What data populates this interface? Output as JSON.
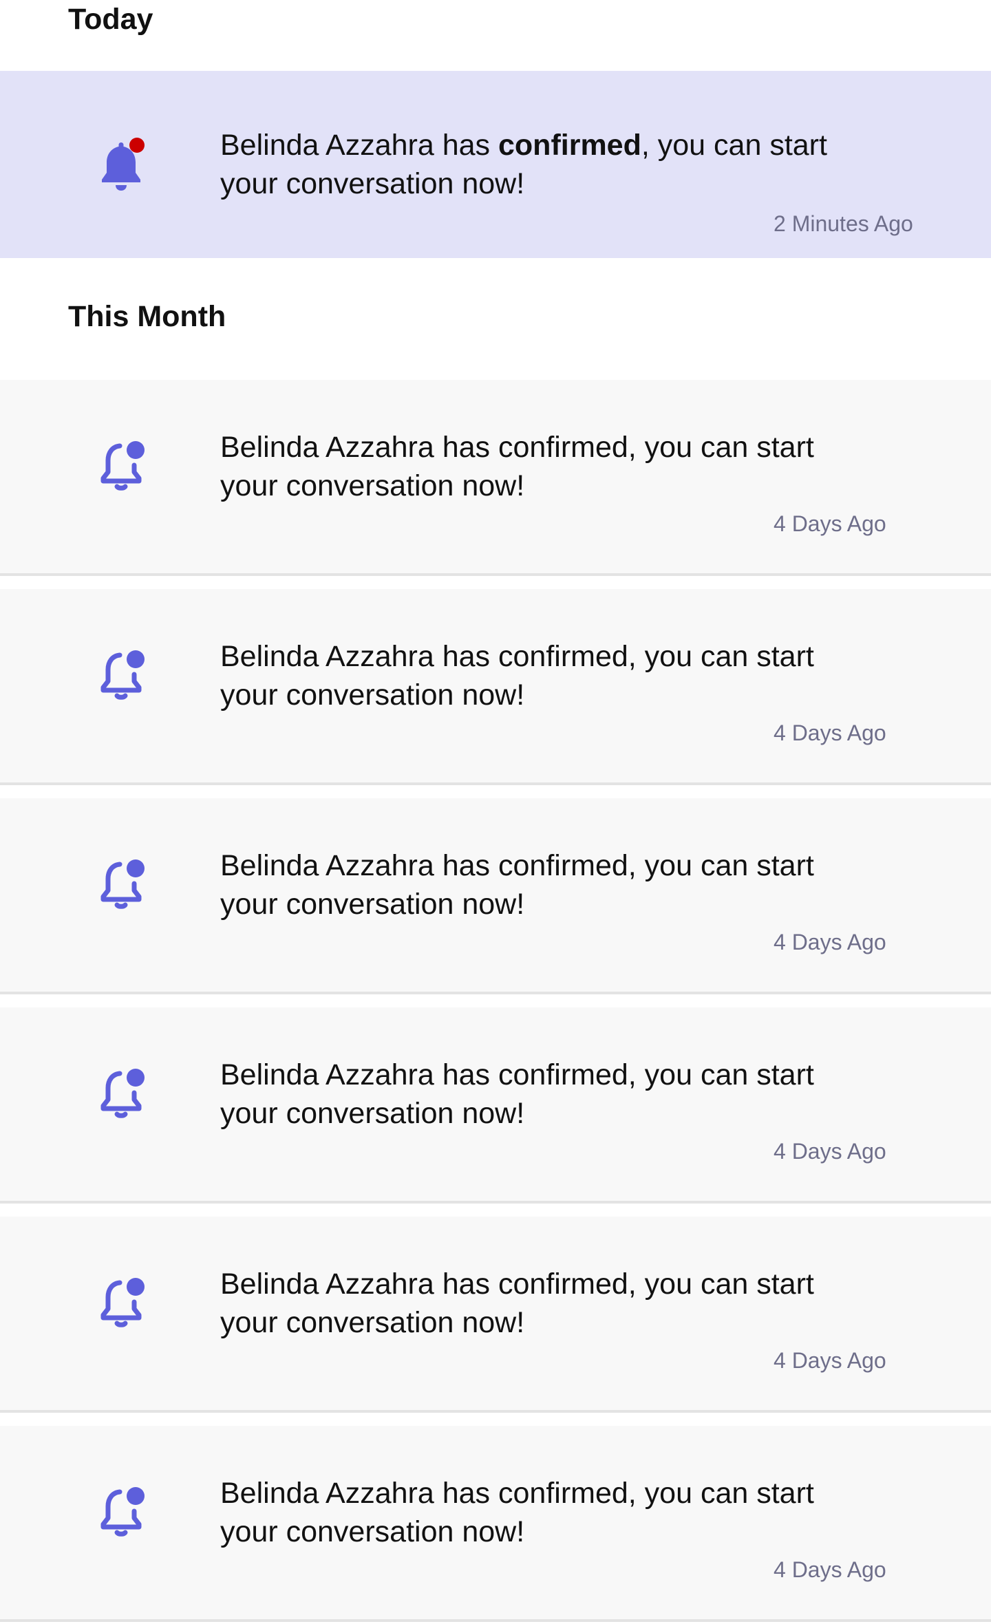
{
  "sections": {
    "today": "Today",
    "this_month": "This Month"
  },
  "notifications_today": [
    {
      "name": "Belinda Azzahra",
      "pre": " has ",
      "status": "confirmed",
      "post": ", you can start your conversation now!",
      "time": "2 Minutes Ago",
      "unread": true,
      "icon": "bell-filled-with-red-dot-icon"
    }
  ],
  "notifications_month": [
    {
      "text": "Belinda Azzahra has confirmed, you can start your conversation now!",
      "time": "4 Days Ago",
      "icon": "bell-outline-with-dot-icon"
    },
    {
      "text": "Belinda Azzahra has confirmed, you can start your conversation now!",
      "time": "4 Days Ago",
      "icon": "bell-outline-with-dot-icon"
    },
    {
      "text": "Belinda Azzahra has confirmed, you can start your conversation now!",
      "time": "4 Days Ago",
      "icon": "bell-outline-with-dot-icon"
    },
    {
      "text": "Belinda Azzahra has confirmed, you can start your conversation now!",
      "time": "4 Days Ago",
      "icon": "bell-outline-with-dot-icon"
    },
    {
      "text": "Belinda Azzahra has confirmed, you can start your conversation now!",
      "time": "4 Days Ago",
      "icon": "bell-outline-with-dot-icon"
    },
    {
      "text": "Belinda Azzahra has confirmed, you can start your conversation now!",
      "time": "4 Days Ago",
      "icon": "bell-outline-with-dot-icon"
    }
  ],
  "colors": {
    "accent": "#5d5fdb",
    "unread_background": "#e2e2f8",
    "read_background": "#f8f8f8",
    "badge_red": "#cc0000",
    "timestamp": "#6e6e8a"
  }
}
